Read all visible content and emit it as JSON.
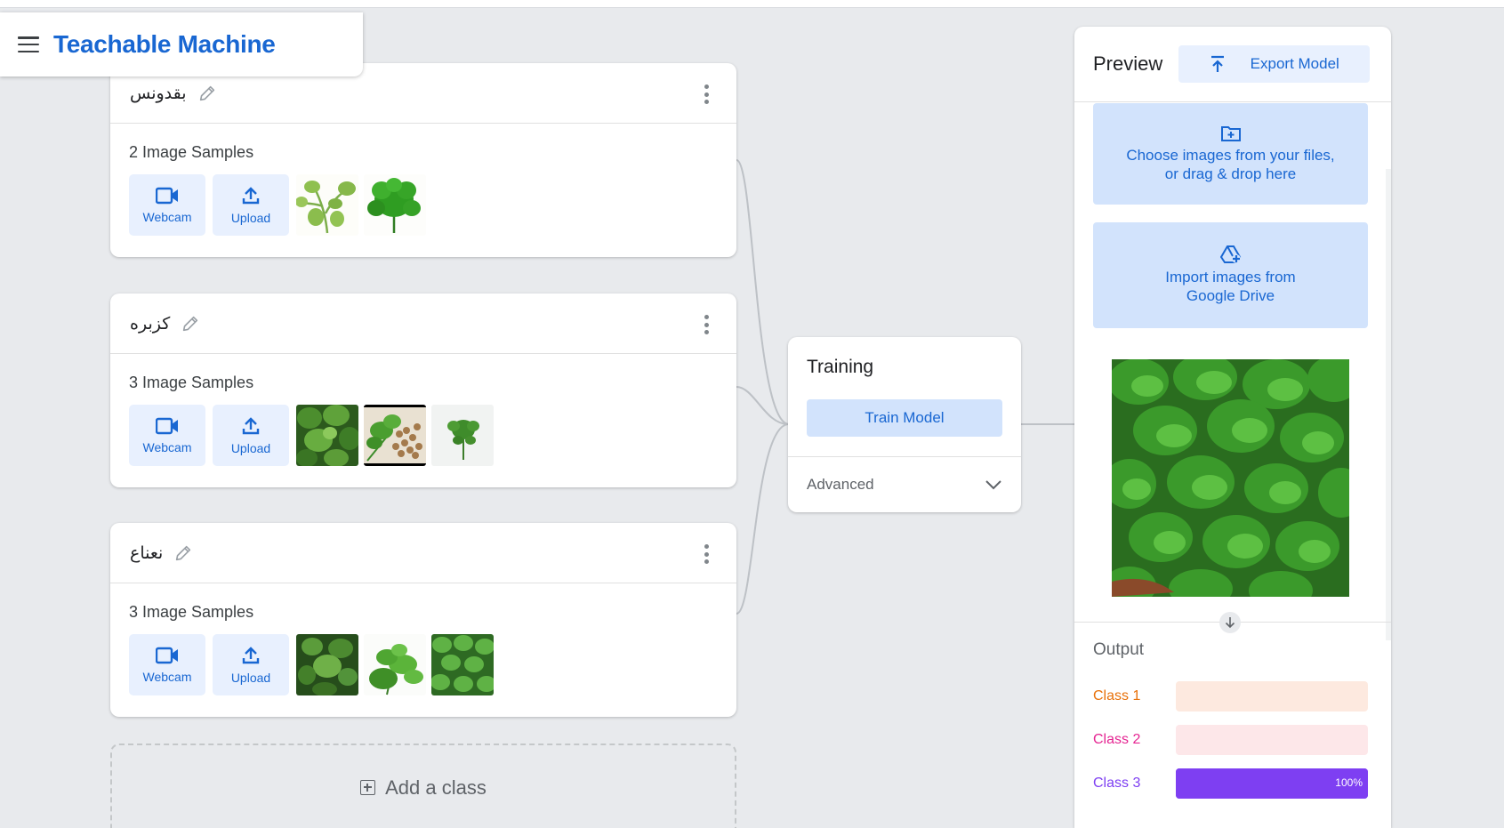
{
  "app": {
    "title": "Teachable Machine"
  },
  "classes": [
    {
      "name": "بقدونس",
      "samples_label": "2 Image Samples",
      "webcam_label": "Webcam",
      "upload_label": "Upload"
    },
    {
      "name": "كزبره",
      "samples_label": "3 Image Samples",
      "webcam_label": "Webcam",
      "upload_label": "Upload"
    },
    {
      "name": "نعناع",
      "samples_label": "3 Image Samples",
      "webcam_label": "Webcam",
      "upload_label": "Upload"
    }
  ],
  "add_class": {
    "label": "Add a class"
  },
  "training": {
    "title": "Training",
    "train_label": "Train Model",
    "advanced_label": "Advanced"
  },
  "preview": {
    "title": "Preview",
    "export_label": "Export Model",
    "files_line1": "Choose images from your files,",
    "files_line2": "or drag & drop here",
    "drive_line1": "Import images from",
    "drive_line2": "Google Drive"
  },
  "output": {
    "title": "Output",
    "rows": [
      {
        "label": "Class 1",
        "value": 0,
        "color": "#e8710a",
        "bg": "#fde9df"
      },
      {
        "label": "Class 2",
        "value": 0,
        "color": "#e52592",
        "bg": "#fde7e9"
      },
      {
        "label": "Class 3",
        "value": 100,
        "color": "#7e3ff2",
        "bg": "#7e3ff2",
        "pct_text": "100%"
      }
    ]
  },
  "colors": {
    "accent": "#1967d2",
    "light_blue": "#e8f0fe",
    "mid_blue": "#d2e3fc",
    "leaf_green": "#3aa63a"
  }
}
